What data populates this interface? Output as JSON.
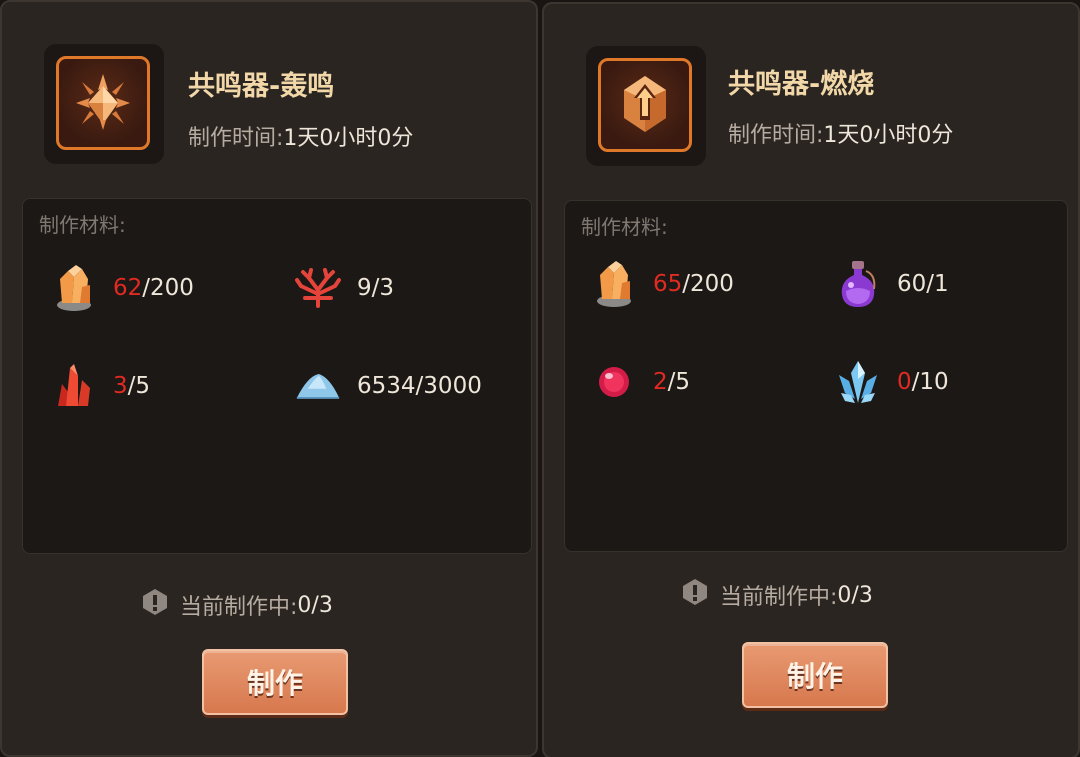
{
  "panels": [
    {
      "title": "共鸣器-轰鸣",
      "time_label": "制作时间:",
      "time_value": "1天0小时0分",
      "materials_label": "制作材料:",
      "materials": [
        {
          "icon": "orange-crystal-ore-icon",
          "have": "62",
          "need": "200",
          "have_color": "red"
        },
        {
          "icon": "red-coral-icon",
          "have": "9",
          "need": "3",
          "have_color": "ok"
        },
        {
          "icon": "red-crystal-icon",
          "have": "3",
          "need": "5",
          "have_color": "red"
        },
        {
          "icon": "blue-powder-pile-icon",
          "have": "6534",
          "need": "3000",
          "have_color": "ok"
        }
      ],
      "status_label": "当前制作中:",
      "status_value": "0/3",
      "button_label": "制作"
    },
    {
      "title": "共鸣器-燃烧",
      "time_label": "制作时间:",
      "time_value": "1天0小时0分",
      "materials_label": "制作材料:",
      "materials": [
        {
          "icon": "orange-crystal-ore-icon",
          "have": "65",
          "need": "200",
          "have_color": "red"
        },
        {
          "icon": "purple-potion-icon",
          "have": "60",
          "need": "1",
          "have_color": "ok"
        },
        {
          "icon": "red-orb-icon",
          "have": "2",
          "need": "5",
          "have_color": "red"
        },
        {
          "icon": "blue-crystal-cluster-icon",
          "have": "0",
          "need": "10",
          "have_color": "red"
        }
      ],
      "status_label": "当前制作中:",
      "status_value": "0/3",
      "button_label": "制作"
    }
  ],
  "colors": {
    "accent": "#e0782a",
    "title": "#f2d8a8",
    "shortage": "#e02a22",
    "button": "#d7784e"
  }
}
